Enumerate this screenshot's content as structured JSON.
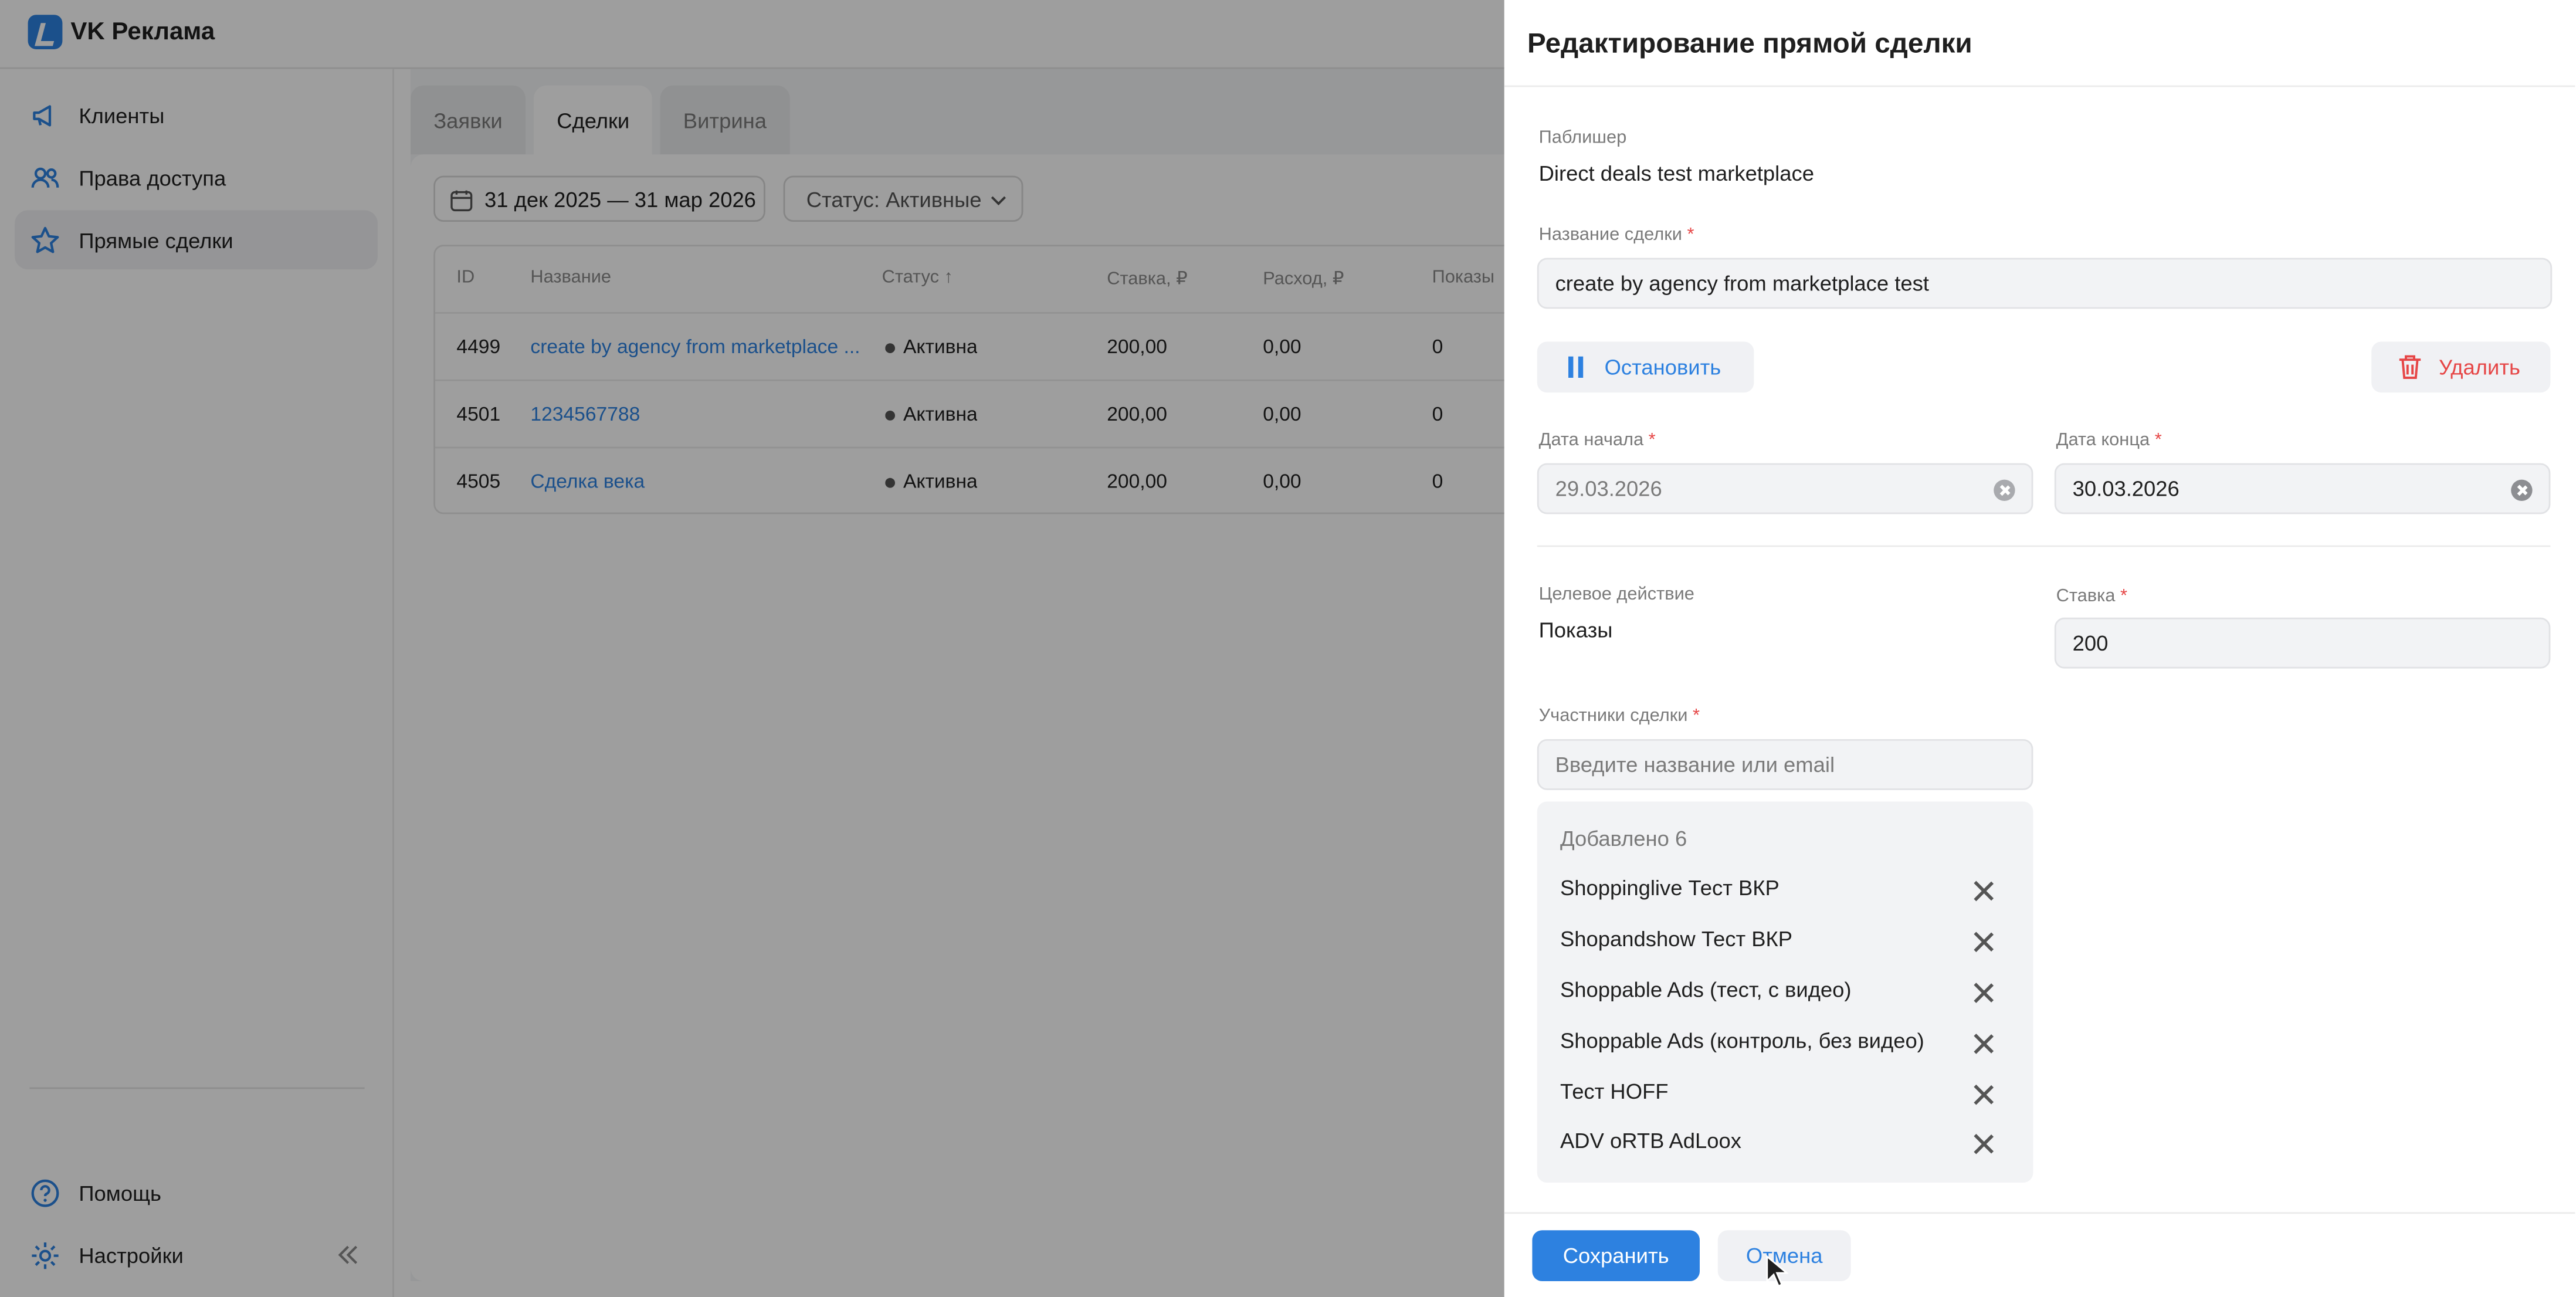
{
  "app": {
    "brand": "VK Реклама"
  },
  "sidebar": {
    "items": [
      {
        "label": "Клиенты",
        "icon": "megaphone-icon"
      },
      {
        "label": "Права доступа",
        "icon": "users-icon"
      },
      {
        "label": "Прямые сделки",
        "icon": "star-icon",
        "active": true
      }
    ],
    "bottom": [
      {
        "label": "Помощь",
        "icon": "help-icon"
      },
      {
        "label": "Настройки",
        "icon": "gear-icon"
      }
    ]
  },
  "tabs": [
    "Заявки",
    "Сделки",
    "Витрина"
  ],
  "filters": {
    "date_range": "31 дек 2025 — 31 мар 2026",
    "status": "Статус: Активные"
  },
  "table": {
    "headers": [
      "ID",
      "Название",
      "Статус ↑",
      "Ставка, ₽",
      "Расход, ₽",
      "Показы"
    ],
    "rows": [
      {
        "id": "4499",
        "name": "create by agency from marketplace ...",
        "status": "Активна",
        "rate": "200,00",
        "spend": "0,00",
        "shows": "0"
      },
      {
        "id": "4501",
        "name": "1234567788",
        "status": "Активна",
        "rate": "200,00",
        "spend": "0,00",
        "shows": "0"
      },
      {
        "id": "4505",
        "name": "Сделка века",
        "status": "Активна",
        "rate": "200,00",
        "spend": "0,00",
        "shows": "0"
      }
    ]
  },
  "panel": {
    "title": "Редактирование прямой сделки",
    "publisher_label": "Паблишер",
    "publisher_value": "Direct deals test marketplace",
    "deal_name_label": "Название сделки",
    "deal_name_value": "create by agency from marketplace test",
    "pause_button": "Остановить",
    "delete_button": "Удалить",
    "start_label": "Дата начала",
    "start_value": "29.03.2026",
    "end_label": "Дата конца",
    "end_value": "30.03.2026",
    "target_label": "Целевое действие",
    "target_value": "Показы",
    "rate_label": "Ставка",
    "rate_value": "200",
    "participants_label": "Участники сделки",
    "participants_placeholder": "Введите название или email",
    "added_label": "Добавлено 6",
    "participants": [
      "Shoppinglive Тест ВКР",
      "Shopandshow Тест ВКР",
      "Shoppable Ads (тест, с видео)",
      "Shoppable Ads (контроль, без видео)",
      "Тест HOFF",
      "ADV oRTB AdLoox"
    ],
    "required_mark": "*",
    "save_button": "Сохранить",
    "cancel_button": "Отмена"
  },
  "colors": {
    "accent": "#2d81e0",
    "danger": "#e64646"
  }
}
